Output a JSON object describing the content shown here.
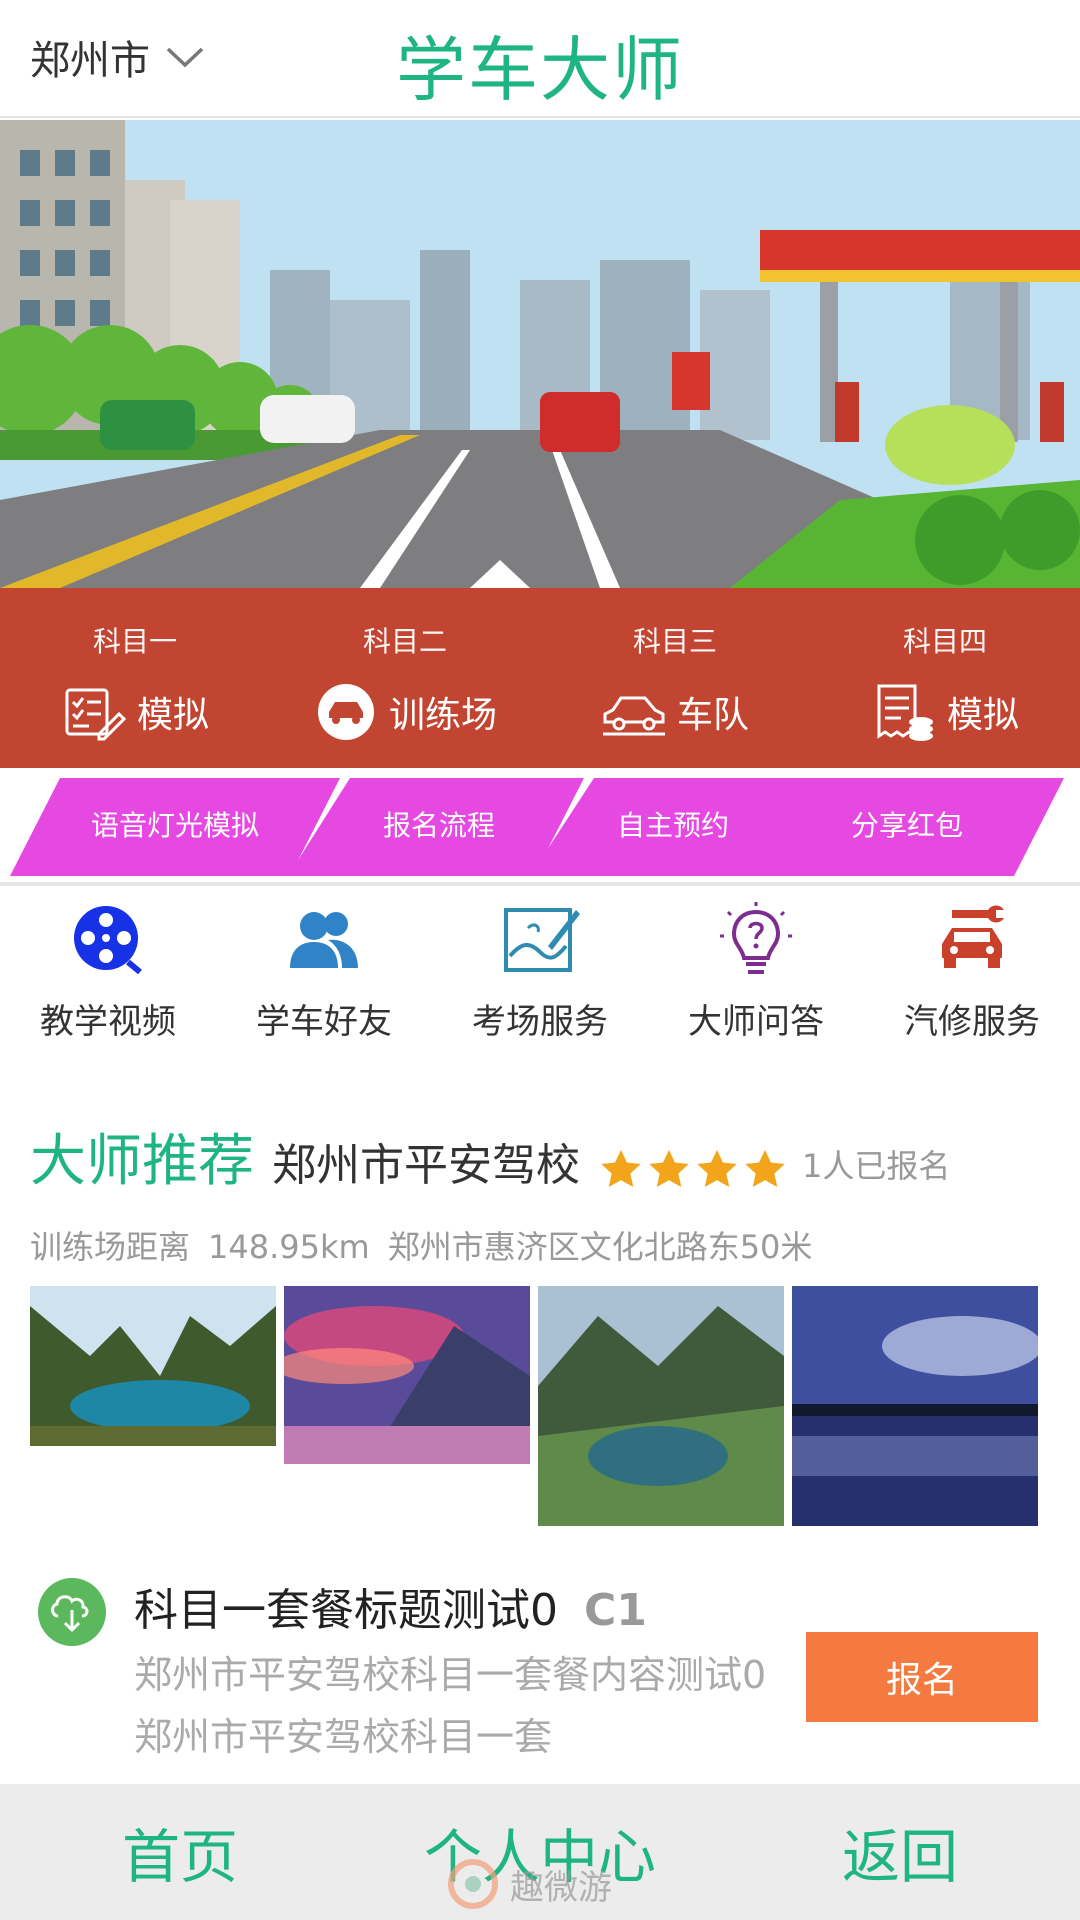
{
  "header": {
    "city": "郑州市",
    "title": "学车大师"
  },
  "subjects": [
    {
      "title": "科目一",
      "label": "模拟",
      "icon": "checklist-pencil-icon"
    },
    {
      "title": "科目二",
      "label": "训练场",
      "icon": "car-circle-icon"
    },
    {
      "title": "科目三",
      "label": "车队",
      "icon": "car-outline-icon"
    },
    {
      "title": "科目四",
      "label": "模拟",
      "icon": "receipt-coins-icon"
    }
  ],
  "strip_tabs": [
    "语音灯光模拟",
    "报名流程",
    "自主预约",
    "分享红包"
  ],
  "grid": [
    {
      "label": "教学视频",
      "icon": "film-reel-icon",
      "color": "#1631e6"
    },
    {
      "label": "学车好友",
      "icon": "friends-icon",
      "color": "#2f83c6"
    },
    {
      "label": "考场服务",
      "icon": "landscape-pen-icon",
      "color": "#2f8bb0"
    },
    {
      "label": "大师问答",
      "icon": "lightbulb-question-icon",
      "color": "#7d2c8f"
    },
    {
      "label": "汽修服务",
      "icon": "car-wrench-icon",
      "color": "#c9412b"
    }
  ],
  "recommend": {
    "title": "大师推荐",
    "school": "郑州市平安驾校",
    "stars": 4,
    "enrolled": "1人已报名",
    "distance_label": "训练场距离",
    "distance": "148.95km",
    "address": "郑州市惠济区文化北路东50米"
  },
  "package": {
    "title": "科目一套餐标题测试0",
    "license": "C1",
    "desc": "郑州市平安驾校科目一套餐内容测试0郑州市平安驾校科目一套",
    "button": "报名",
    "icon": "cloud-download-icon"
  },
  "nav": [
    "首页",
    "个人中心",
    "返回"
  ],
  "watermark": "趣微游",
  "colors": {
    "accent": "#1fb583",
    "subjects_bg": "#c24531",
    "strip_tab": "#e649e1",
    "button": "#f47a3f"
  }
}
